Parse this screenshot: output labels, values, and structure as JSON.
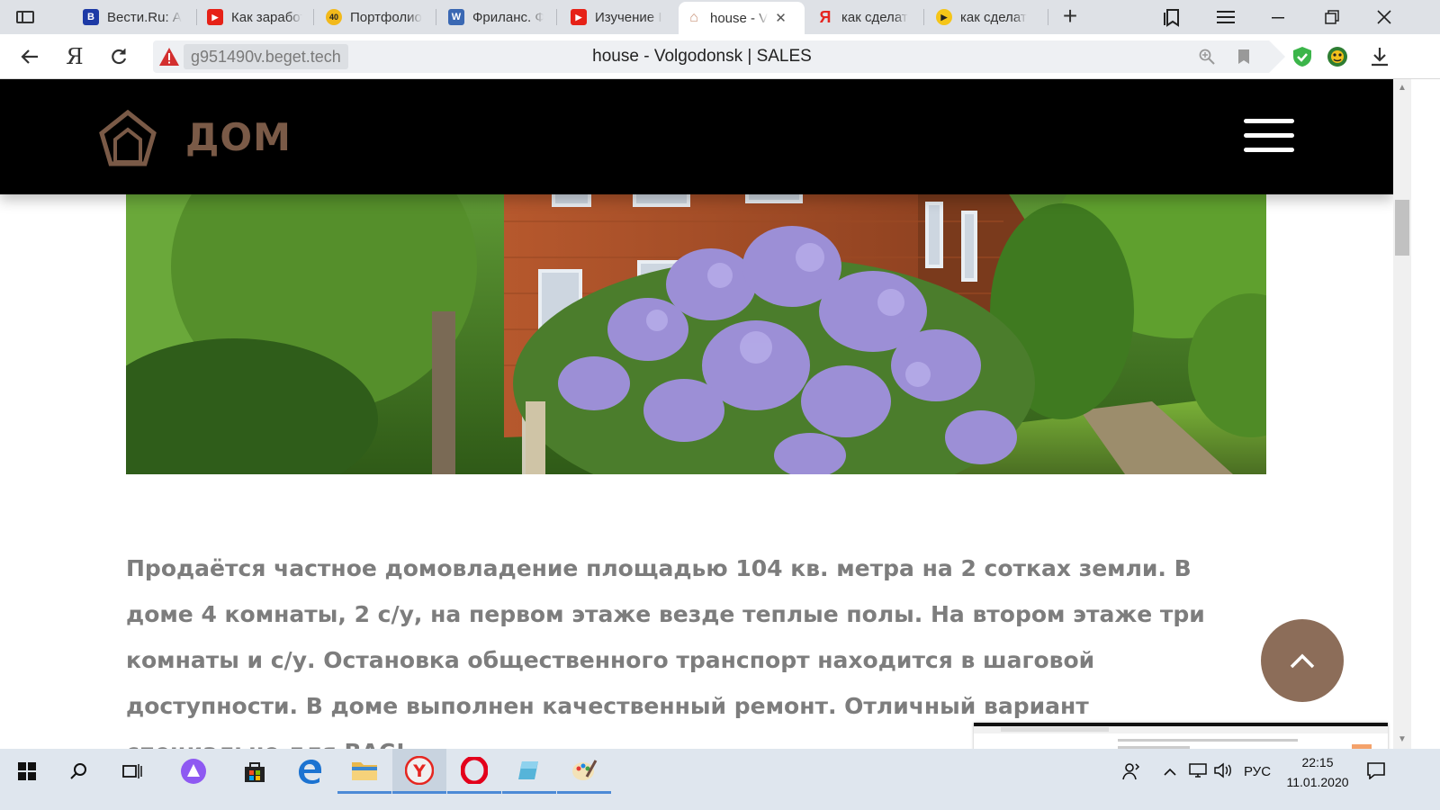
{
  "browser": {
    "tabs": [
      {
        "label": "Вести.Ru: А",
        "fav": "В",
        "fav_color": "#1d3aa6"
      },
      {
        "label": "Как заработ",
        "fav": "▶",
        "fav_color": "#e62117"
      },
      {
        "label": "Портфолио",
        "fav": "40",
        "fav_color": "#f2b91b"
      },
      {
        "label": "Фриланс. Ф",
        "fav": "W",
        "fav_color": "#3a68b3"
      },
      {
        "label": "Изучение I",
        "fav": "▶",
        "fav_color": "#e62117"
      },
      {
        "label": "house - V",
        "fav": "⌂",
        "fav_color": "#c89278"
      },
      {
        "label": "как сделат",
        "fav": "Я",
        "fav_color": "#e52620"
      },
      {
        "label": "как сделат",
        "fav": "▶",
        "fav_color": "#f5c518"
      }
    ],
    "address": {
      "domain": "g951490v.beget.tech",
      "title": "house - Volgodonsk | SALES"
    }
  },
  "site": {
    "logo_text": "ДОМ",
    "description": "Продаётся частное домовладение площадью 104 кв. метра на 2 сотках земли. В доме 4 комнаты, 2 с/у, на первом этаже везде теплые полы. На втором этаже три комнаты и с/у. Остановка общественного транспорт находится в шаговой доступности. В доме выполнен качественный ремонт. Отличный вариант специально для ВАС!"
  },
  "taskbar": {
    "language": "РУС",
    "time": "22:15",
    "date": "11.01.2020"
  },
  "colors": {
    "brand_brown": "#8c6d59",
    "header_bg": "#000000",
    "text_gray": "#7d7d7d"
  }
}
